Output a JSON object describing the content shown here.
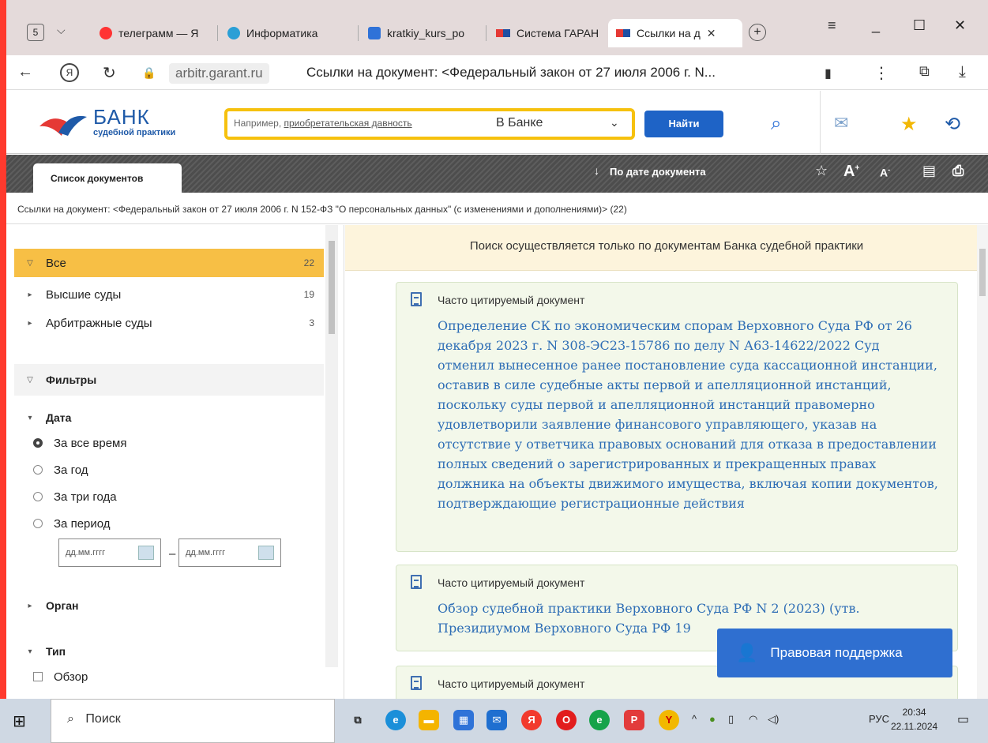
{
  "browser": {
    "tab_count": "5",
    "tabs": [
      {
        "label": "телеграмм — Я",
        "icon": "yandex-icon"
      },
      {
        "label": "Информатика",
        "icon": "telegram-icon"
      },
      {
        "label": "kratkiy_kurs_po",
        "icon": "document-icon"
      },
      {
        "label": "Система ГАРАН",
        "icon": "garant-icon"
      },
      {
        "label": "Ссылки на д",
        "icon": "garant-icon"
      }
    ],
    "new_tab": "+",
    "url_host": "arbitr.garant.ru",
    "url_title": "Ссылки на документ: <Федеральный закон от 27 июля 2006 г. N..."
  },
  "site": {
    "logo_title": "БАНК",
    "logo_subtitle": "судебной практики",
    "search_prefix": "Например, ",
    "search_example": "приобретательская давность",
    "search_scope": "В Банке",
    "find_label": "Найти"
  },
  "toolbar": {
    "doc_list_tab": "Список документов",
    "sort_label": "По дате документа",
    "font_up": "A",
    "font_down": "A"
  },
  "breadcrumb": "Ссылки на документ: <Федеральный закон от 27 июля 2006 г. N 152-ФЗ \"О персональных данных\" (с изменениями и дополнениями)> (22)",
  "sidebar": {
    "all": {
      "label": "Все",
      "count": "22"
    },
    "high_courts": {
      "label": "Высшие суды",
      "count": "19"
    },
    "arb_courts": {
      "label": "Арбитражные суды",
      "count": "3"
    },
    "filters": "Фильтры",
    "date": "Дата",
    "date_options": [
      "За все время",
      "За год",
      "За три года",
      "За период"
    ],
    "date_placeholder": "дд.мм.гггг",
    "organ": "Орган",
    "type": "Тип",
    "type_options": [
      "Обзор"
    ]
  },
  "main": {
    "notice": "Поиск осуществляется только по документам Банка судебной практики",
    "cards": [
      {
        "kind": "Часто цитируемый документ",
        "title": "Определение СК по экономическим спорам Верховного Суда РФ от 26 декабря 2023 г. N 308-ЭС23-15786 по делу N А63-14622/2022 Суд отменил вынесенное ранее постановление суда кассационной инстанции, оставив в силе судебные акты первой и апелляционной инстанций, поскольку суды первой и апелляционной инстанций правомерно удовлетворили заявление финансового управляющего, указав на отсутствие у ответчика правовых оснований для отказа в предоставлении полных сведений о зарегистрированных и прекращенных правах должника на объекты движимого имущества, включая копии документов, подтверждающие регистрационные действия"
      },
      {
        "kind": "Часто цитируемый документ",
        "title": "Обзор судебной практики Верховного Суда РФ N 2 (2023) (утв. Президиумом Верховного Суда РФ 19"
      },
      {
        "kind": "Часто цитируемый документ",
        "title": ""
      }
    ],
    "support_label": "Правовая поддержка"
  },
  "taskbar": {
    "search_label": "Поиск",
    "lang": "РУС",
    "time": "20:34",
    "date": "22.11.2024"
  }
}
